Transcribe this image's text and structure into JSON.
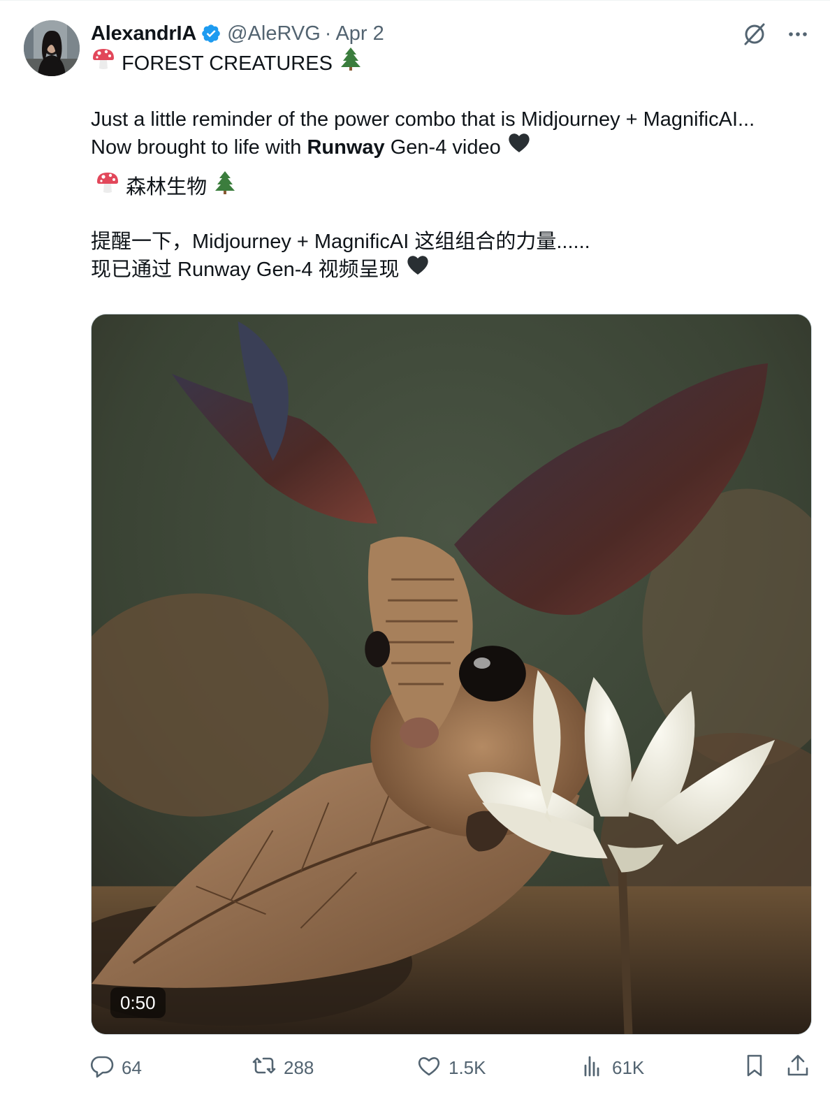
{
  "author": {
    "name": "AlexandrIA",
    "handle": "@AleRVG",
    "separator": "·",
    "date": "Apr 2",
    "verified": true
  },
  "post": {
    "title_en": "FOREST CREATURES",
    "en_line1": "Just a little reminder of the power combo that is Midjourney + MagnificAI...",
    "en_line2_pre": "Now brought to life with ",
    "en_line2_bold": "Runway",
    "en_line2_post": " Gen-4 video",
    "title_zh": "森林生物",
    "zh_line1": "提醒一下，Midjourney + MagnificAI 这组组合的力量......",
    "zh_line2": "现已通过 Runway Gen-4 视频呈现"
  },
  "media": {
    "type": "video",
    "duration": "0:50"
  },
  "actions": {
    "replies": "64",
    "reposts": "288",
    "likes": "1.5K",
    "views": "61K"
  },
  "icons": {
    "verified": "verified-badge-icon",
    "grok": "grok-icon",
    "more": "more-icon",
    "reply": "reply-icon",
    "repost": "repost-icon",
    "like": "heart-icon",
    "views": "views-icon",
    "bookmark": "bookmark-icon",
    "share": "share-icon",
    "mushroom": "mushroom-emoji",
    "tree": "evergreen-tree-emoji",
    "heart": "black-heart-emoji"
  },
  "colors": {
    "text": "#0f1419",
    "secondary": "#536471",
    "verified": "#1d9bf0",
    "border": "#cfd9de"
  }
}
